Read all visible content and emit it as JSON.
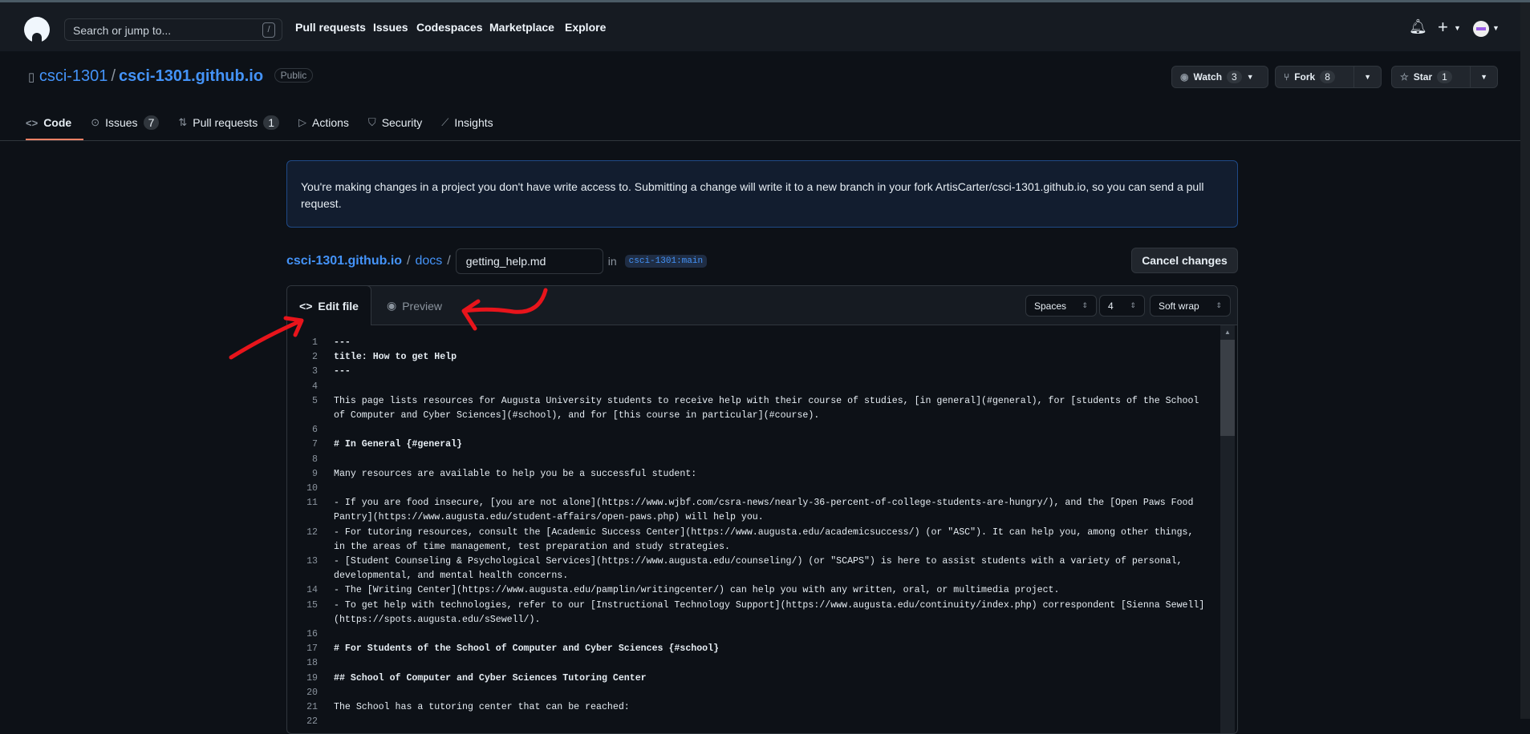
{
  "header": {
    "search_placeholder": "Search or jump to...",
    "search_shortcut": "/",
    "nav": [
      "Pull requests",
      "Issues",
      "Codespaces",
      "Marketplace",
      "Explore"
    ]
  },
  "repo": {
    "owner": "csci-1301",
    "name": "csci-1301.github.io",
    "visibility": "Public",
    "watch_label": "Watch",
    "watch_count": "3",
    "fork_label": "Fork",
    "fork_count": "8",
    "star_label": "Star",
    "star_count": "1"
  },
  "tabs": [
    {
      "label": "Code",
      "icon": "code-icon"
    },
    {
      "label": "Issues",
      "count": "7",
      "icon": "issue-icon"
    },
    {
      "label": "Pull requests",
      "count": "1",
      "icon": "pull-request-icon"
    },
    {
      "label": "Actions",
      "icon": "play-icon"
    },
    {
      "label": "Security",
      "icon": "shield-icon"
    },
    {
      "label": "Insights",
      "icon": "graph-icon"
    }
  ],
  "banner": "You're making changes in a project you don't have write access to. Submitting a change will write it to a new branch in your fork ArtisCarter/csci-1301.github.io, so you can send a pull request.",
  "path": {
    "root": "csci-1301.github.io",
    "folder": "docs",
    "filename": "getting_help.md",
    "in_label": "in",
    "branch": "csci-1301:main",
    "cancel_label": "Cancel changes"
  },
  "editor": {
    "edit_tab": "Edit file",
    "preview_tab": "Preview",
    "indent_mode": "Spaces",
    "indent_size": "4",
    "wrap_mode": "Soft wrap",
    "lines": [
      "---",
      "title: How to get Help",
      "---",
      "",
      "This page lists resources for Augusta University students to receive help with their course of studies, [in general](#general), for [students of the School of Computer and Cyber Sciences](#school), and for [this course in particular](#course).",
      "",
      "# In General {#general}",
      "",
      "Many resources are available to help you be a successful student:",
      "",
      "- If you are food insecure, [you are not alone](https://www.wjbf.com/csra-news/nearly-36-percent-of-college-students-are-hungry/), and the [Open Paws Food Pantry](https://www.augusta.edu/student-affairs/open-paws.php) will help you.",
      "- For tutoring resources, consult the [Academic Success Center](https://www.augusta.edu/academicsuccess/) (or \"ASC\"). It can help you, among other things, in the areas of time management, test preparation and study strategies.",
      "- [Student Counseling & Psychological Services](https://www.augusta.edu/counseling/) (or \"SCAPS\") is here to assist students with a variety of personal, developmental, and mental health concerns.",
      "- The [Writing Center](https://www.augusta.edu/pamplin/writingcenter/) can help you with any written, oral, or multimedia project.",
      "- To get help with technologies, refer to our [Instructional Technology Support](https://www.augusta.edu/continuity/index.php) correspondent [Sienna Sewell](https://spots.augusta.edu/sSewell/).",
      "",
      "# For Students of the School of Computer and Cyber Sciences {#school}",
      "",
      "## School of Computer and Cyber Sciences Tutoring Center",
      "",
      "The School has a tutoring center that can be reached:",
      ""
    ]
  },
  "colors": {
    "accent": "#4493f8",
    "annotation": "#e8141b",
    "tab_underline": "#f78166"
  }
}
